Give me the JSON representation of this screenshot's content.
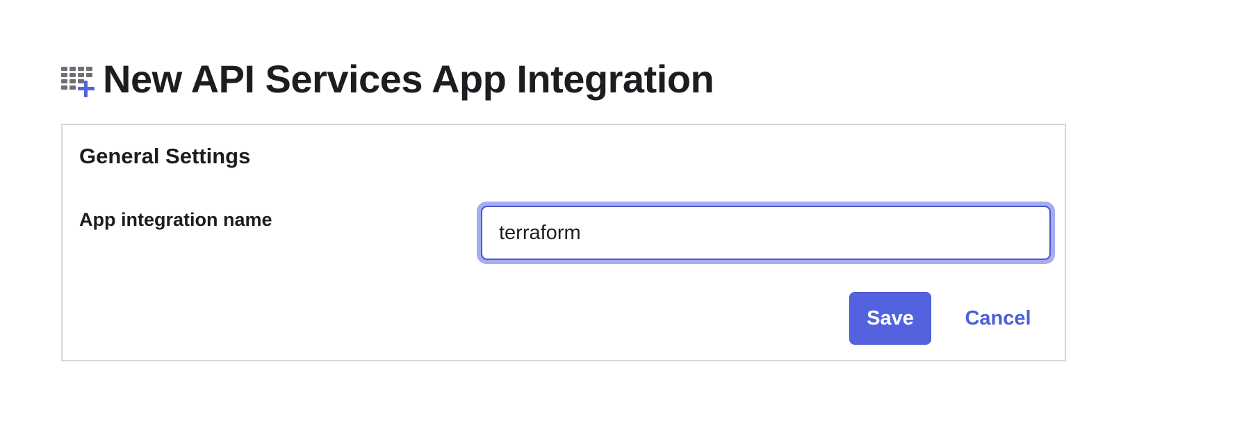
{
  "header": {
    "title": "New API Services App Integration",
    "icon": "app-grid-add-icon"
  },
  "general_settings": {
    "heading": "General Settings",
    "app_name_label": "App integration name",
    "app_name_value": "terraform"
  },
  "actions": {
    "save_label": "Save",
    "cancel_label": "Cancel"
  },
  "colors": {
    "accent": "#5363df",
    "focus_ring": "#a6acf0",
    "link": "#4e5ed9",
    "border": "#d7d7dc",
    "icon_gray": "#6f6f75"
  }
}
